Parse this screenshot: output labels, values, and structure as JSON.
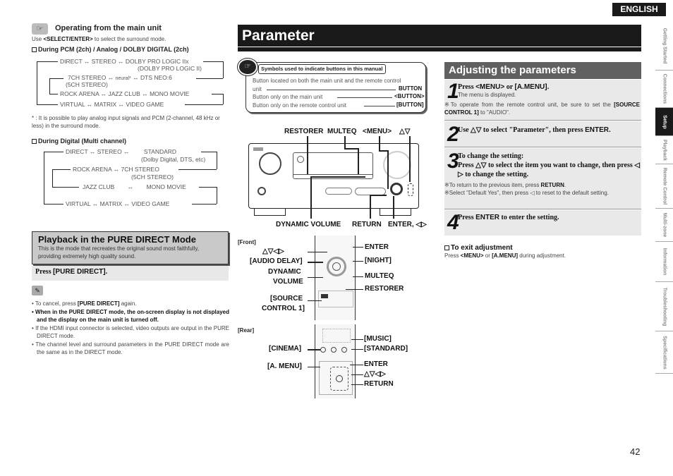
{
  "header": {
    "language": "ENGLISH"
  },
  "left": {
    "operating": {
      "icon": "hand-pointer-icon",
      "title": "Operating from the main unit",
      "use_prefix": "Use ",
      "use_button": "<SELECT/ENTER>",
      "use_suffix": " to select the surround mode."
    },
    "pcm": {
      "heading": "During PCM (2ch) / Analog / DOLBY DIGITAL (2ch)",
      "rows": [
        [
          "DIRECT",
          "STEREO",
          "DOLBY PRO LOGIC IIx"
        ],
        [
          "7CH STEREO",
          "neural*",
          "DTS NEO:6"
        ],
        [
          "ROCK ARENA",
          "JAZZ CLUB",
          "MONO MOVIE"
        ],
        [
          "VIRTUAL",
          "MATRIX",
          "VIDEO GAME"
        ]
      ],
      "sub_dolby": "(DOLBY PRO LOGIC II)",
      "sub_7ch": "(5CH STEREO)",
      "footnote": "*  : It is possible to play analog input signals and PCM (2-channel, 48 kHz or less) in the surround mode."
    },
    "digital": {
      "heading": "During Digital (Multi channel)",
      "rows": [
        [
          "DIRECT",
          "STEREO",
          "STANDARD"
        ],
        [
          "ROCK ARENA",
          "7CH STEREO"
        ],
        [
          "JAZZ CLUB",
          "MONO MOVIE"
        ],
        [
          "VIRTUAL",
          "MATRIX",
          "VIDEO GAME"
        ]
      ],
      "sub_standard": "(Dolby Digital, DTS, etc)",
      "sub_7ch": "(5CH STEREO)"
    },
    "pure_direct": {
      "title": "Playback in the PURE DIRECT Mode",
      "desc": "This is the mode that recreates the original sound most faithfully, providing extremely high quality sound.",
      "press_prefix": "Press ",
      "press_button": "[PURE DIRECT].",
      "notes": [
        {
          "pre": "To cancel, press ",
          "btn": "[PURE DIRECT]",
          "post": " again.",
          "bold": false
        },
        {
          "text": "When in the PURE DIRECT mode, the on-screen display is not displayed and the display on the main unit is turned off.",
          "bold": true
        },
        {
          "text": "If the HDMI input connector is selected, video outputs are output in the PURE DIRECT mode.",
          "bold": false
        },
        {
          "text": "The channel level and surround parameters in the PURE DIRECT mode are the same as in the DIRECT mode.",
          "bold": false
        }
      ]
    }
  },
  "middle": {
    "title": "Parameter",
    "symbols": {
      "heading": "Symbols used to indicate buttons in this manual",
      "row1a": "Button located on both the main unit and the remote control",
      "row1b": "unit",
      "row1_btn": "BUTTON",
      "row2": "Button only on the main unit",
      "row2_btn": "<BUTTON>",
      "row3": "Button only on the remote control unit",
      "row3_btn": "[BUTTON]"
    },
    "receiver_labels": {
      "restorer": "RESTORER",
      "multeq": "MULTEQ",
      "menu": "<MENU>",
      "updown": "△▽",
      "dynamic_volume": "DYNAMIC VOLUME",
      "return": "RETURN",
      "enter": "ENTER, ◁▷"
    },
    "front": {
      "caption": "[Front]",
      "arrows": "△▽◁▷",
      "audio_delay": "[AUDIO DELAY]",
      "dynamic1": "DYNAMIC",
      "dynamic2": "VOLUME",
      "source1": "[SOURCE",
      "source2": "CONTROL 1]",
      "enter": "ENTER",
      "night": "[NIGHT]",
      "multeq": "MULTEQ",
      "restorer": "RESTORER"
    },
    "rear": {
      "caption": "[Rear]",
      "cinema": "[CINEMA]",
      "amenu": "[A. MENU]",
      "music": "[MUSIC]",
      "standard": "[STANDARD]",
      "enter": "ENTER",
      "arrows": "△▽◁▷",
      "return": "RETURN"
    }
  },
  "right": {
    "title": "Adjusting the parameters",
    "steps": [
      {
        "num": "1",
        "pre": "Press ",
        "btn": "<MENU>",
        "mid": " or ",
        "btn2": "[A.MENU].",
        "sub": "The menu is displayed.",
        "note_pre": "※To operate from the remote control unit, be sure to set the ",
        "note_btn": "[SOURCE CONTROL 1]",
        "note_post": " to \"AUDIO\"."
      },
      {
        "num": "2",
        "pre": "Use △▽ to select \"Parameter\", then press ",
        "btn": "ENTER."
      },
      {
        "num": "3",
        "line1": "To change the setting:",
        "line2": "Press △▽ to select the item you want to change, then press ◁ ▷ to change the setting.",
        "note1_pre": "※To return to the previous item, press ",
        "note1_btn": "RETURN",
        "note1_post": ".",
        "note2": "※Select \"Default Yes\", then press ◁ to reset to the default setting."
      },
      {
        "num": "4",
        "pre": "Press ",
        "btn": "ENTER",
        "post": " to enter the setting."
      }
    ],
    "exit": {
      "heading": "To exit adjustment",
      "pre": "Press ",
      "btn1": "<MENU>",
      "mid": " or ",
      "btn2": "[A.MENU]",
      "post": " during adjustment."
    }
  },
  "side_tabs": [
    {
      "label": "Getting Started",
      "active": false
    },
    {
      "label": "Connections",
      "active": false
    },
    {
      "label": "Setup",
      "active": true
    },
    {
      "label": "Playback",
      "active": false
    },
    {
      "label": "Remote Control",
      "active": false
    },
    {
      "label": "Multi-zone",
      "active": false
    },
    {
      "label": "Information",
      "active": false
    },
    {
      "label": "Troubleshooting",
      "active": false
    },
    {
      "label": "Specifications",
      "active": false
    }
  ],
  "page_number": "42"
}
